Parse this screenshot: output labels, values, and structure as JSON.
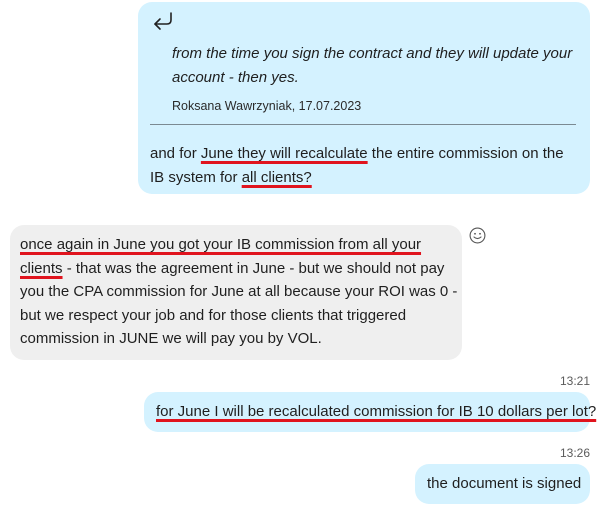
{
  "messages": {
    "reply": {
      "quote_text": "from the time you sign the contract and they will update your account - then yes.",
      "quote_author": "Roksana Wawrzyniak, 17.07.2023",
      "body": {
        "p1": "and for ",
        "u1": "June they will recalculate",
        "p2": " the entire commission on the IB system for ",
        "u2": "all clients?"
      }
    },
    "incoming": {
      "u1": "once again in June you got your IB commission from all your clients",
      "p1": " - that was the agreement in June - but we should not pay you the CPA commission for June at all because your ROI was 0 - but we respect your job and for those clients that triggered commission in JUNE we will pay you by VOL."
    },
    "outgoing1": {
      "time": "13:21",
      "text": "for June I will be recalculated commission for IB 10 dollars per lot?"
    },
    "outgoing2": {
      "time": "13:26",
      "text": "the document is signed"
    }
  },
  "colors": {
    "outgoing_bubble": "#d4f2ff",
    "incoming_bubble": "#efefef",
    "underline": "#e0141e"
  },
  "icons": [
    "reply-arrow-icon",
    "smiley-reaction-icon"
  ]
}
